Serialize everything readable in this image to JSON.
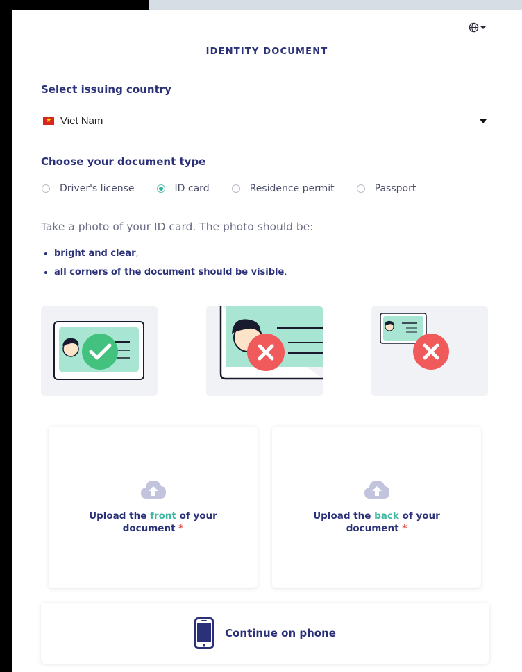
{
  "header": {
    "title": "IDENTITY DOCUMENT",
    "language_icon": "globe-icon"
  },
  "country": {
    "label": "Select issuing country",
    "value": "Viet Nam",
    "flag": "vn-flag"
  },
  "document_type": {
    "label": "Choose your document type",
    "options": [
      "Driver's license",
      "ID card",
      "Residence permit",
      "Passport"
    ],
    "selected": "ID card"
  },
  "instructions": {
    "text": "Take a photo of your ID card. The photo should be:",
    "bullets": [
      {
        "text": "bright and clear",
        "punct": ","
      },
      {
        "text": "all corners of the document should be visible",
        "punct": "."
      }
    ]
  },
  "examples": [
    {
      "kind": "good",
      "icon": "check-icon"
    },
    {
      "kind": "too-close",
      "icon": "cross-icon"
    },
    {
      "kind": "too-far",
      "icon": "cross-icon"
    }
  ],
  "upload": {
    "front": {
      "before": "Upload the ",
      "accent": "front",
      "after": " of your",
      "line2": "document",
      "required": "*"
    },
    "back": {
      "before": "Upload the ",
      "accent": "back",
      "after": " of your",
      "line2": "document",
      "required": "*"
    }
  },
  "phone": {
    "label": "Continue on phone"
  },
  "colors": {
    "primary": "#2b3178",
    "accent": "#3fb8a3",
    "error": "#f05a5a",
    "success": "#43c27f"
  }
}
